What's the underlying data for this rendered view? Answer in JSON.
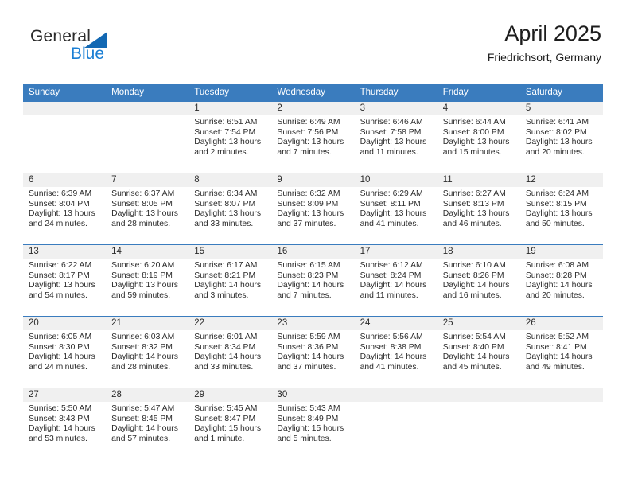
{
  "brand": {
    "name_part1": "General",
    "name_part2": "Blue",
    "triangle_color": "#1268b3",
    "blue_color": "#1b7fd4"
  },
  "header": {
    "title": "April 2025",
    "subtitle": "Friedrichsort, Germany",
    "header_bg": "#3a7cbe",
    "band_bg": "#f0f0f0"
  },
  "weekdays": [
    "Sunday",
    "Monday",
    "Tuesday",
    "Wednesday",
    "Thursday",
    "Friday",
    "Saturday"
  ],
  "weeks": [
    [
      {
        "day": ""
      },
      {
        "day": ""
      },
      {
        "day": "1",
        "sunrise": "Sunrise: 6:51 AM",
        "sunset": "Sunset: 7:54 PM",
        "daylight1": "Daylight: 13 hours",
        "daylight2": "and 2 minutes."
      },
      {
        "day": "2",
        "sunrise": "Sunrise: 6:49 AM",
        "sunset": "Sunset: 7:56 PM",
        "daylight1": "Daylight: 13 hours",
        "daylight2": "and 7 minutes."
      },
      {
        "day": "3",
        "sunrise": "Sunrise: 6:46 AM",
        "sunset": "Sunset: 7:58 PM",
        "daylight1": "Daylight: 13 hours",
        "daylight2": "and 11 minutes."
      },
      {
        "day": "4",
        "sunrise": "Sunrise: 6:44 AM",
        "sunset": "Sunset: 8:00 PM",
        "daylight1": "Daylight: 13 hours",
        "daylight2": "and 15 minutes."
      },
      {
        "day": "5",
        "sunrise": "Sunrise: 6:41 AM",
        "sunset": "Sunset: 8:02 PM",
        "daylight1": "Daylight: 13 hours",
        "daylight2": "and 20 minutes."
      }
    ],
    [
      {
        "day": "6",
        "sunrise": "Sunrise: 6:39 AM",
        "sunset": "Sunset: 8:04 PM",
        "daylight1": "Daylight: 13 hours",
        "daylight2": "and 24 minutes."
      },
      {
        "day": "7",
        "sunrise": "Sunrise: 6:37 AM",
        "sunset": "Sunset: 8:05 PM",
        "daylight1": "Daylight: 13 hours",
        "daylight2": "and 28 minutes."
      },
      {
        "day": "8",
        "sunrise": "Sunrise: 6:34 AM",
        "sunset": "Sunset: 8:07 PM",
        "daylight1": "Daylight: 13 hours",
        "daylight2": "and 33 minutes."
      },
      {
        "day": "9",
        "sunrise": "Sunrise: 6:32 AM",
        "sunset": "Sunset: 8:09 PM",
        "daylight1": "Daylight: 13 hours",
        "daylight2": "and 37 minutes."
      },
      {
        "day": "10",
        "sunrise": "Sunrise: 6:29 AM",
        "sunset": "Sunset: 8:11 PM",
        "daylight1": "Daylight: 13 hours",
        "daylight2": "and 41 minutes."
      },
      {
        "day": "11",
        "sunrise": "Sunrise: 6:27 AM",
        "sunset": "Sunset: 8:13 PM",
        "daylight1": "Daylight: 13 hours",
        "daylight2": "and 46 minutes."
      },
      {
        "day": "12",
        "sunrise": "Sunrise: 6:24 AM",
        "sunset": "Sunset: 8:15 PM",
        "daylight1": "Daylight: 13 hours",
        "daylight2": "and 50 minutes."
      }
    ],
    [
      {
        "day": "13",
        "sunrise": "Sunrise: 6:22 AM",
        "sunset": "Sunset: 8:17 PM",
        "daylight1": "Daylight: 13 hours",
        "daylight2": "and 54 minutes."
      },
      {
        "day": "14",
        "sunrise": "Sunrise: 6:20 AM",
        "sunset": "Sunset: 8:19 PM",
        "daylight1": "Daylight: 13 hours",
        "daylight2": "and 59 minutes."
      },
      {
        "day": "15",
        "sunrise": "Sunrise: 6:17 AM",
        "sunset": "Sunset: 8:21 PM",
        "daylight1": "Daylight: 14 hours",
        "daylight2": "and 3 minutes."
      },
      {
        "day": "16",
        "sunrise": "Sunrise: 6:15 AM",
        "sunset": "Sunset: 8:23 PM",
        "daylight1": "Daylight: 14 hours",
        "daylight2": "and 7 minutes."
      },
      {
        "day": "17",
        "sunrise": "Sunrise: 6:12 AM",
        "sunset": "Sunset: 8:24 PM",
        "daylight1": "Daylight: 14 hours",
        "daylight2": "and 11 minutes."
      },
      {
        "day": "18",
        "sunrise": "Sunrise: 6:10 AM",
        "sunset": "Sunset: 8:26 PM",
        "daylight1": "Daylight: 14 hours",
        "daylight2": "and 16 minutes."
      },
      {
        "day": "19",
        "sunrise": "Sunrise: 6:08 AM",
        "sunset": "Sunset: 8:28 PM",
        "daylight1": "Daylight: 14 hours",
        "daylight2": "and 20 minutes."
      }
    ],
    [
      {
        "day": "20",
        "sunrise": "Sunrise: 6:05 AM",
        "sunset": "Sunset: 8:30 PM",
        "daylight1": "Daylight: 14 hours",
        "daylight2": "and 24 minutes."
      },
      {
        "day": "21",
        "sunrise": "Sunrise: 6:03 AM",
        "sunset": "Sunset: 8:32 PM",
        "daylight1": "Daylight: 14 hours",
        "daylight2": "and 28 minutes."
      },
      {
        "day": "22",
        "sunrise": "Sunrise: 6:01 AM",
        "sunset": "Sunset: 8:34 PM",
        "daylight1": "Daylight: 14 hours",
        "daylight2": "and 33 minutes."
      },
      {
        "day": "23",
        "sunrise": "Sunrise: 5:59 AM",
        "sunset": "Sunset: 8:36 PM",
        "daylight1": "Daylight: 14 hours",
        "daylight2": "and 37 minutes."
      },
      {
        "day": "24",
        "sunrise": "Sunrise: 5:56 AM",
        "sunset": "Sunset: 8:38 PM",
        "daylight1": "Daylight: 14 hours",
        "daylight2": "and 41 minutes."
      },
      {
        "day": "25",
        "sunrise": "Sunrise: 5:54 AM",
        "sunset": "Sunset: 8:40 PM",
        "daylight1": "Daylight: 14 hours",
        "daylight2": "and 45 minutes."
      },
      {
        "day": "26",
        "sunrise": "Sunrise: 5:52 AM",
        "sunset": "Sunset: 8:41 PM",
        "daylight1": "Daylight: 14 hours",
        "daylight2": "and 49 minutes."
      }
    ],
    [
      {
        "day": "27",
        "sunrise": "Sunrise: 5:50 AM",
        "sunset": "Sunset: 8:43 PM",
        "daylight1": "Daylight: 14 hours",
        "daylight2": "and 53 minutes."
      },
      {
        "day": "28",
        "sunrise": "Sunrise: 5:47 AM",
        "sunset": "Sunset: 8:45 PM",
        "daylight1": "Daylight: 14 hours",
        "daylight2": "and 57 minutes."
      },
      {
        "day": "29",
        "sunrise": "Sunrise: 5:45 AM",
        "sunset": "Sunset: 8:47 PM",
        "daylight1": "Daylight: 15 hours",
        "daylight2": "and 1 minute."
      },
      {
        "day": "30",
        "sunrise": "Sunrise: 5:43 AM",
        "sunset": "Sunset: 8:49 PM",
        "daylight1": "Daylight: 15 hours",
        "daylight2": "and 5 minutes."
      },
      {
        "day": ""
      },
      {
        "day": ""
      },
      {
        "day": ""
      }
    ]
  ]
}
